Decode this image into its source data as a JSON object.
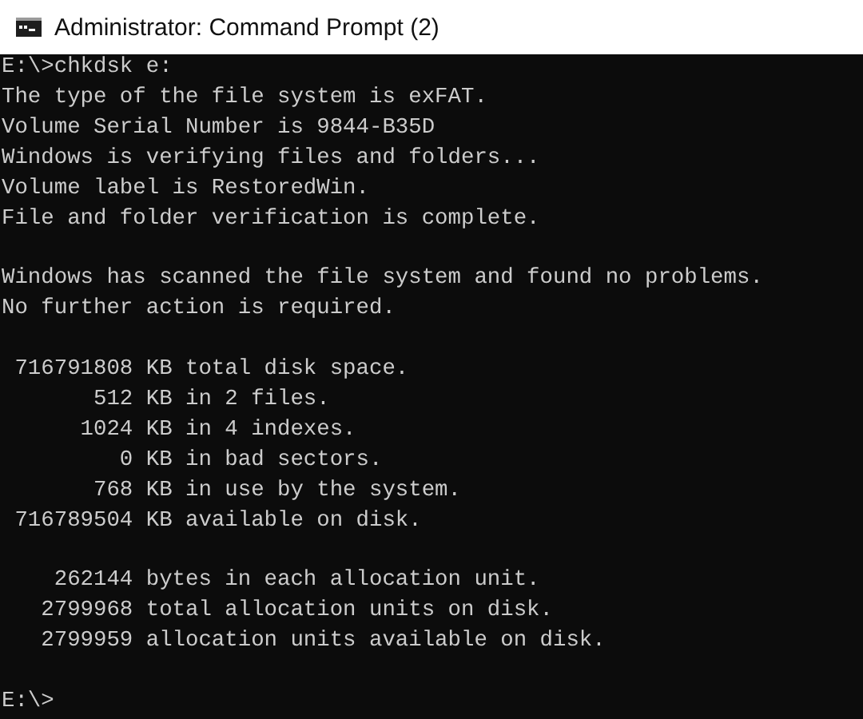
{
  "window": {
    "title": "Administrator: Command Prompt (2)"
  },
  "console": {
    "blocks": [
      [
        "E:\\>chkdsk e:",
        "The type of the file system is exFAT.",
        "Volume Serial Number is 9844-B35D",
        "Windows is verifying files and folders...",
        "Volume label is RestoredWin.",
        "File and folder verification is complete."
      ],
      [
        "Windows has scanned the file system and found no problems.",
        "No further action is required."
      ],
      [
        " 716791808 KB total disk space.",
        "       512 KB in 2 files.",
        "      1024 KB in 4 indexes.",
        "         0 KB in bad sectors.",
        "       768 KB in use by the system.",
        " 716789504 KB available on disk."
      ],
      [
        "    262144 bytes in each allocation unit.",
        "   2799968 total allocation units on disk.",
        "   2799959 allocation units available on disk."
      ],
      [
        "E:\\>"
      ]
    ]
  }
}
